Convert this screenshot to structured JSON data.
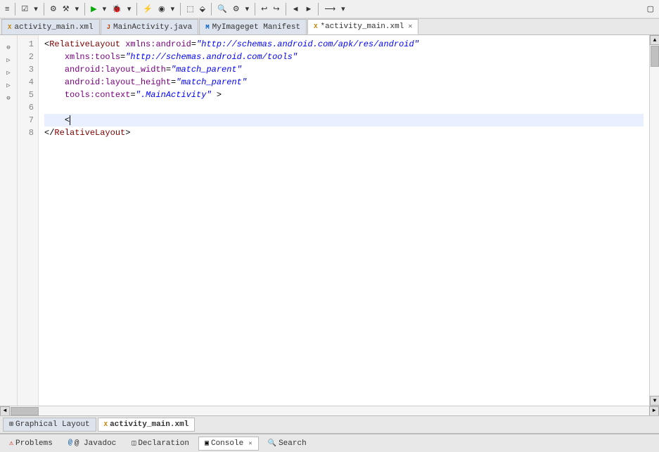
{
  "toolbar": {
    "rows": [
      {
        "buttons": [
          {
            "label": "≡",
            "name": "menu-button"
          },
          {
            "label": "◂",
            "name": "back-button"
          },
          {
            "label": "▾",
            "name": "back-dropdown"
          },
          {
            "separator": true
          },
          {
            "label": "⚡",
            "name": "run-button"
          },
          {
            "label": "▶",
            "name": "play-button"
          },
          {
            "label": "▾",
            "name": "play-dropdown"
          },
          {
            "separator": true
          },
          {
            "label": "⛏",
            "name": "build-button"
          },
          {
            "label": "◉",
            "name": "record-button"
          },
          {
            "label": "▾",
            "name": "build-dropdown"
          },
          {
            "separator": true
          },
          {
            "label": "⬚",
            "name": "snippet-button"
          },
          {
            "label": "⬙",
            "name": "snippet2-button"
          },
          {
            "separator": true
          },
          {
            "label": "🔍",
            "name": "search-toolbar-button"
          },
          {
            "label": "⚙",
            "name": "settings-button"
          },
          {
            "label": "▾",
            "name": "settings-dropdown"
          },
          {
            "separator": true
          },
          {
            "label": "↩",
            "name": "undo-button"
          },
          {
            "label": "↪",
            "name": "redo-button"
          },
          {
            "separator": true
          },
          {
            "label": "◄",
            "name": "prev-button"
          },
          {
            "label": "►",
            "name": "next-button"
          },
          {
            "label": "⬛",
            "name": "blank-button"
          },
          {
            "separator": true
          }
        ]
      }
    ]
  },
  "tabs": [
    {
      "label": "activity_main.xml",
      "icon": "xml-icon",
      "active": false,
      "closeable": false,
      "name": "tab-activity-main-xml"
    },
    {
      "label": "MainActivity.java",
      "icon": "java-icon",
      "active": false,
      "closeable": false,
      "name": "tab-mainactivity-java"
    },
    {
      "label": "MyImageget Manifest",
      "icon": "manifest-icon",
      "active": false,
      "closeable": false,
      "name": "tab-manifest"
    },
    {
      "label": "*activity_main.xml",
      "icon": "xml-icon",
      "active": true,
      "closeable": true,
      "name": "tab-activity-main-xml-active"
    }
  ],
  "editor": {
    "lines": [
      {
        "num": 1,
        "content": "<RelativeLayout xmlns:android=\"http://schemas.android.com/apk/res/android\"",
        "highlighted": false
      },
      {
        "num": 2,
        "content": "    xmlns:tools=\"http://schemas.android.com/tools\"",
        "highlighted": false
      },
      {
        "num": 3,
        "content": "    android:layout_width=\"match_parent\"",
        "highlighted": false
      },
      {
        "num": 4,
        "content": "    android:layout_height=\"match_parent\"",
        "highlighted": false
      },
      {
        "num": 5,
        "content": "    tools:context=\".MainActivity\" >",
        "highlighted": false
      },
      {
        "num": 6,
        "content": "",
        "highlighted": false
      },
      {
        "num": 7,
        "content": "    <",
        "highlighted": true,
        "has_cursor": true
      },
      {
        "num": 8,
        "content": "</RelativeLayout>",
        "highlighted": false
      }
    ]
  },
  "bottom_tabs": [
    {
      "label": "Graphical Layout",
      "icon": "layout-icon",
      "active": false,
      "name": "tab-graphical-layout"
    },
    {
      "label": "activity_main.xml",
      "icon": "xml-icon2",
      "active": true,
      "name": "tab-activity-main-xml-bottom"
    }
  ],
  "panel_tabs": [
    {
      "label": "Problems",
      "icon": "problems-icon",
      "active": false,
      "name": "tab-problems"
    },
    {
      "label": "@ Javadoc",
      "icon": "javadoc-icon",
      "active": false,
      "name": "tab-javadoc"
    },
    {
      "label": "Declaration",
      "icon": "declaration-icon",
      "active": false,
      "name": "tab-declaration"
    },
    {
      "label": "Console",
      "icon": "console-icon",
      "active": false,
      "name": "tab-console"
    },
    {
      "label": "Search",
      "icon": "search-panel-icon",
      "active": false,
      "name": "tab-search"
    }
  ],
  "colors": {
    "active_tab_bg": "#ffffff",
    "inactive_tab_bg": "#dde3ec",
    "editor_bg": "#ffffff",
    "highlighted_line": "#e8f0ff",
    "line_number_color": "#888888",
    "xml_tag": "#800000",
    "xml_attr": "#7b0080",
    "xml_value": "#0000ff",
    "toolbar_bg": "#f0f0f0"
  }
}
